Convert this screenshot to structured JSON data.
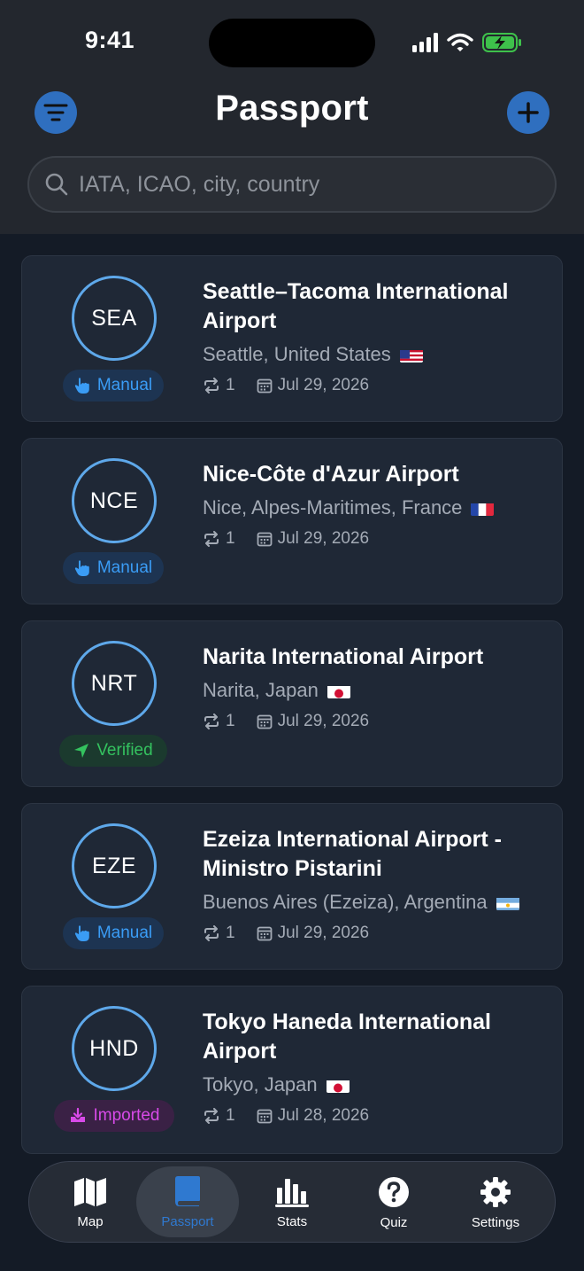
{
  "status": {
    "time": "9:41"
  },
  "header": {
    "title": "Passport"
  },
  "search": {
    "placeholder": "IATA, ICAO, city, country"
  },
  "airports": [
    {
      "code": "SEA",
      "name": "Seattle–Tacoma International Airport",
      "location": "Seattle, United States",
      "flag": "us-flag",
      "badge": "Manual",
      "visits": "1",
      "date": "Jul 29, 2026"
    },
    {
      "code": "NCE",
      "name": "Nice-Côte d'Azur Airport",
      "location": "Nice, Alpes-Maritimes, France",
      "flag": "fr-flag",
      "badge": "Manual",
      "visits": "1",
      "date": "Jul 29, 2026"
    },
    {
      "code": "NRT",
      "name": "Narita International Airport",
      "location": "Narita, Japan",
      "flag": "jp-flag",
      "badge": "Verified",
      "visits": "1",
      "date": "Jul 29, 2026"
    },
    {
      "code": "EZE",
      "name": "Ezeiza International Airport - Ministro Pistarini",
      "location": "Buenos Aires (Ezeiza), Argentina",
      "flag": "ar-flag",
      "badge": "Manual",
      "visits": "1",
      "date": "Jul 29, 2026"
    },
    {
      "code": "HND",
      "name": "Tokyo Haneda International Airport",
      "location": "Tokyo, Japan",
      "flag": "jp-flag",
      "badge": "Imported",
      "visits": "1",
      "date": "Jul 28, 2026"
    }
  ],
  "tabs": [
    {
      "label": "Map",
      "icon": "map-icon"
    },
    {
      "label": "Passport",
      "icon": "book-icon",
      "active": true
    },
    {
      "label": "Stats",
      "icon": "bar-chart-icon"
    },
    {
      "label": "Quiz",
      "icon": "question-icon"
    },
    {
      "label": "Settings",
      "icon": "gear-icon"
    }
  ],
  "colors": {
    "accent": "#2f6fbf",
    "manual": "#3a9cf5",
    "verified": "#34c25f",
    "imported": "#d84ae8",
    "circle": "#5ea8ea"
  }
}
